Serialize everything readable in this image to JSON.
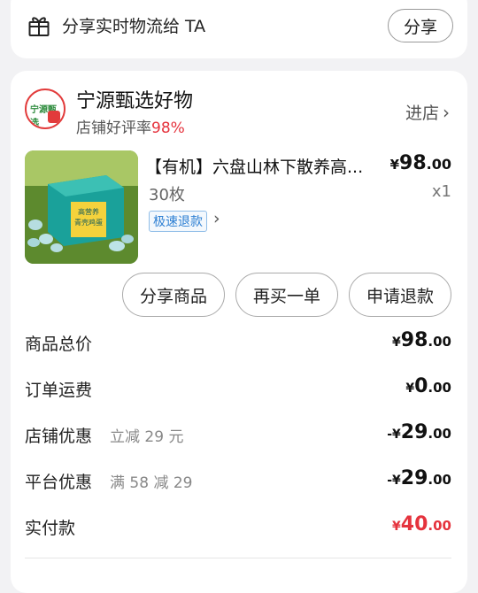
{
  "share": {
    "text": "分享实时物流给 TA",
    "button": "分享"
  },
  "shop": {
    "logo_text": "宁源甄选",
    "name": "宁源甄选好物",
    "rating_label": "店铺好评率",
    "rating_value": "98%",
    "enter": "进店"
  },
  "product": {
    "title": "【有机】六盘山林下散养高...",
    "price_symbol": "¥",
    "price_int": "98",
    "price_dec": ".00",
    "spec": "30枚",
    "qty": "x1",
    "refund_tag": "极速退款",
    "box_text_1": "高营养",
    "box_text_2": "青壳鸡蛋"
  },
  "actions": {
    "share_product": "分享商品",
    "buy_again": "再买一单",
    "refund": "申请退款"
  },
  "summary": {
    "total_label": "商品总价",
    "total_sym": "¥",
    "total_int": "98",
    "total_dec": ".00",
    "shipping_label": "订单运费",
    "shipping_sym": "¥",
    "shipping_int": "0",
    "shipping_dec": ".00",
    "shop_discount_label": "店铺优惠",
    "shop_discount_sub": "立减 29 元",
    "shop_discount_sym": "-¥",
    "shop_discount_int": "29",
    "shop_discount_dec": ".00",
    "platform_discount_label": "平台优惠",
    "platform_discount_sub": "满 58 减 29",
    "platform_discount_sym": "-¥",
    "platform_discount_int": "29",
    "platform_discount_dec": ".00",
    "paid_label": "实付款",
    "paid_sym": "¥",
    "paid_int": "40",
    "paid_dec": ".00"
  },
  "colors": {
    "accent_red": "#e5333d",
    "refund_blue": "#2d7fd3"
  }
}
